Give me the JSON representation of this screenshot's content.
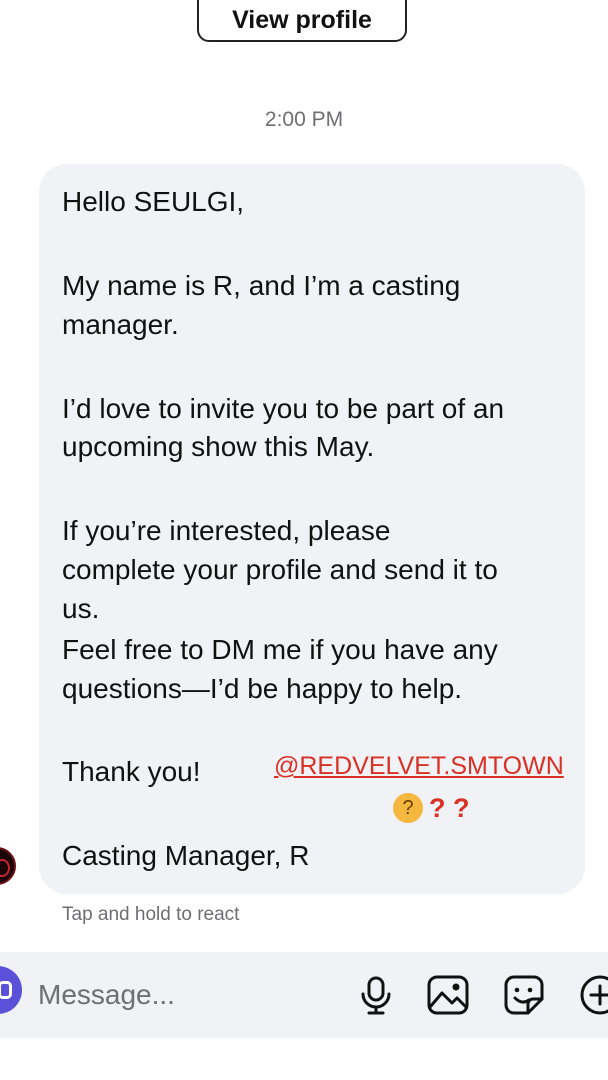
{
  "header": {
    "view_profile_label": "View profile"
  },
  "thread": {
    "timestamp": "2:00 PM",
    "message_lines": [
      "Hello SEULGI,",
      "My name is R, and I’m a casting",
      "manager.",
      "I’d love to invite you to be part of an",
      "upcoming show this May.",
      "If you’re interested, please",
      "complete your profile and send it to",
      "us.",
      "Feel free to DM me if you have any",
      "questions—I’d be happy to help.",
      "Thank you!",
      "Casting Manager, R"
    ],
    "mention": "@REDVELVET.SMTOWN",
    "reaction": {
      "emoji_icon": "thinking-face-emoji",
      "text": "❓❓",
      "emoji": "🤔",
      "question_marks": "? ?"
    },
    "tap_hint": "Tap and hold to react"
  },
  "composer": {
    "placeholder": "Message...",
    "icons": [
      "camera-icon",
      "microphone-icon",
      "image-icon",
      "sticker-icon",
      "plus-icon"
    ]
  },
  "colors": {
    "bubble_bg": "#f0f2f5",
    "mention": "#d93025",
    "muted_text": "#6e6e73",
    "camera_button": "#5b51d8"
  }
}
